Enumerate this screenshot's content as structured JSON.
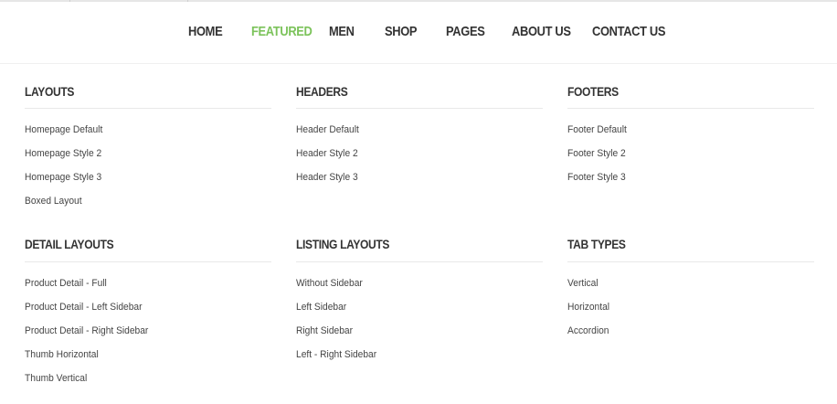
{
  "nav": {
    "items": [
      {
        "label": "HOME",
        "active": false
      },
      {
        "label": "FEATURED",
        "active": true
      },
      {
        "label": "MEN",
        "active": false
      },
      {
        "label": "SHOP",
        "active": false
      },
      {
        "label": "PAGES",
        "active": false
      },
      {
        "label": "ABOUT US",
        "active": false
      },
      {
        "label": "CONTACT US",
        "active": false
      }
    ],
    "active_color": "#7cc35b"
  },
  "megamenu": {
    "columns": [
      {
        "title": "LAYOUTS",
        "links": [
          "Homepage Default",
          "Homepage Style 2",
          "Homepage Style 3",
          "Boxed Layout"
        ]
      },
      {
        "title": "HEADERS",
        "links": [
          "Header Default",
          "Header Style 2",
          "Header Style 3"
        ]
      },
      {
        "title": "FOOTERS",
        "links": [
          "Footer Default",
          "Footer Style 2",
          "Footer Style 3"
        ]
      },
      {
        "title": "DETAIL LAYOUTS",
        "links": [
          "Product Detail - Full",
          "Product Detail - Left Sidebar",
          "Product Detail - Right Sidebar",
          "Thumb Horizontal",
          "Thumb Vertical"
        ]
      },
      {
        "title": "LISTING LAYOUTS",
        "links": [
          "Without Sidebar",
          "Left Sidebar",
          "Right Sidebar",
          "Left - Right Sidebar"
        ]
      },
      {
        "title": "TAB TYPES",
        "links": [
          "Vertical",
          "Horizontal",
          "Accordion"
        ]
      }
    ]
  }
}
